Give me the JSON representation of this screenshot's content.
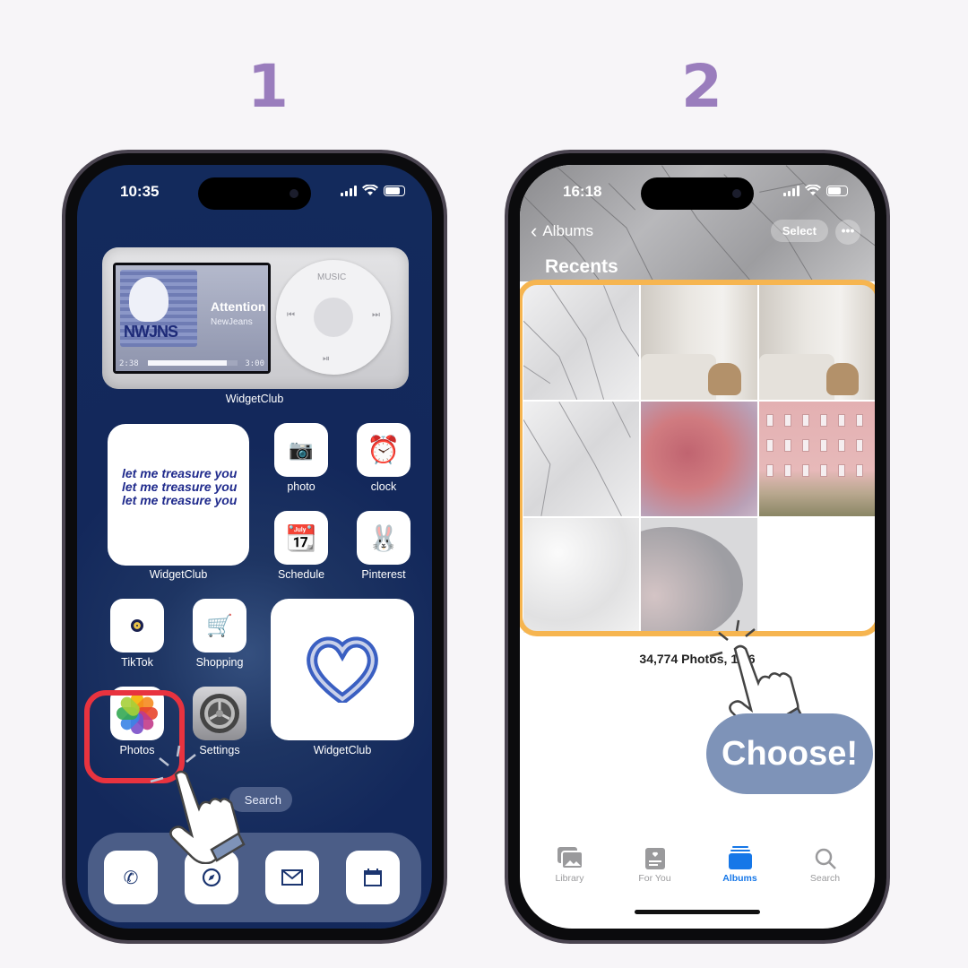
{
  "steps": [
    "1",
    "2"
  ],
  "phone1": {
    "status": {
      "time": "10:35"
    },
    "music_widget": {
      "song": "Attention",
      "artist": "NewJeans",
      "album_art_text": "NWJNS",
      "elapsed": "2:38",
      "total": "3:00",
      "progress": 0.88,
      "wheel_label": "MUSIC",
      "label": "WidgetClub"
    },
    "text_widget": {
      "lines": [
        "let me treasure you",
        "let me treasure you",
        "let me treasure you"
      ],
      "label": "WidgetClub"
    },
    "apps": [
      {
        "name": "photo",
        "icon": "instant-camera-icon"
      },
      {
        "name": "clock",
        "icon": "alarm-clock-icon"
      },
      {
        "name": "Schedule",
        "icon": "desk-calendar-icon"
      },
      {
        "name": "Pinterest",
        "icon": "bunny-figure-icon"
      },
      {
        "name": "TikTok",
        "icon": "eight-ball-icon"
      },
      {
        "name": "Shopping",
        "icon": "shopping-cart-icon"
      },
      {
        "name": "Photos",
        "icon": "photos-flower-icon"
      },
      {
        "name": "Settings",
        "icon": "settings-gear-icon"
      }
    ],
    "heart_widget": {
      "label": "WidgetClub"
    },
    "search_label": "Search",
    "dock": [
      "phone-icon",
      "compass-icon",
      "mail-icon",
      "calendar-icon"
    ],
    "highlight_color": "#e8333f"
  },
  "phone2": {
    "status": {
      "time": "16:18"
    },
    "nav": {
      "back_label": "Albums",
      "select_label": "Select",
      "more_label": "•••"
    },
    "title": "Recents",
    "photos": [
      "marble",
      "bedroom",
      "bedroom",
      "marble",
      "pink-sky",
      "pink-palace",
      "clouds",
      "planet"
    ],
    "count_text": "34,774 Photos, 1,36",
    "choose_label": "Choose!",
    "highlight_color": "#f6b550",
    "tabs": [
      {
        "label": "Library",
        "active": false
      },
      {
        "label": "For You",
        "active": false
      },
      {
        "label": "Albums",
        "active": true
      },
      {
        "label": "Search",
        "active": false
      }
    ]
  },
  "colors": {
    "step_number": "#9a7dbd",
    "accent_blue": "#1677e8",
    "choose_bg": "#7e93b8",
    "wallpaper": "#132a5c"
  }
}
